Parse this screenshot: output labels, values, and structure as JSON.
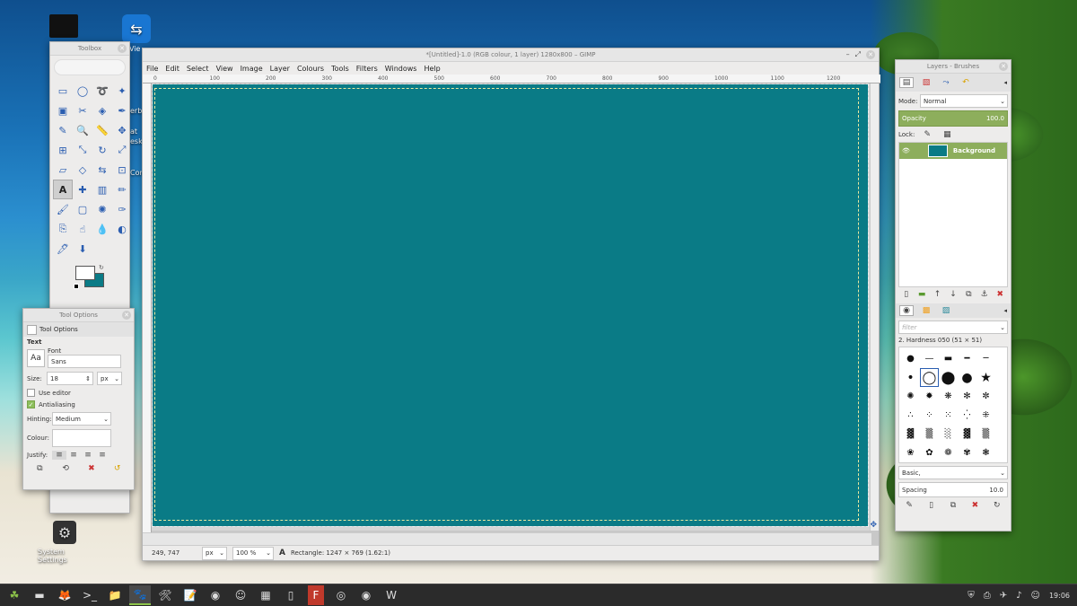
{
  "desktop": {
    "icons": [
      {
        "label": "",
        "glyph": "🖥"
      },
      {
        "label": "Vie",
        "glyph": "⇆"
      },
      {
        "label": "System Settings",
        "glyph": "⚙"
      }
    ],
    "side_fragments": [
      "erb",
      "at",
      "esk",
      "Con",
      "F"
    ]
  },
  "toolbox": {
    "title": "Toolbox",
    "tools": [
      "rect-select",
      "ellipse-select",
      "free-select",
      "fuzzy-select",
      "color-select",
      "scissors",
      "foreground-select",
      "paths",
      "color-picker",
      "zoom",
      "measure",
      "move",
      "align",
      "transform",
      "rotate",
      "scale",
      "shear",
      "perspective",
      "flip",
      "cage",
      "text",
      "heal",
      "gradient",
      "pencil",
      "paintbrush",
      "eraser",
      "airbrush",
      "ink",
      "clone",
      "smudge",
      "blur",
      "dodge",
      "mypaint",
      "bucket"
    ]
  },
  "tool_options": {
    "title": "Tool Options",
    "tab_label": "Tool Options",
    "section": "Text",
    "font_label": "Font",
    "font_preview": "Aa",
    "font_value": "Sans",
    "size_label": "Size:",
    "size_value": "18",
    "size_unit": "px",
    "use_editor": "Use editor",
    "antialiasing": "Antialiasing",
    "antialiasing_checked": true,
    "hinting_label": "Hinting:",
    "hinting_value": "Medium",
    "colour_label": "Colour:",
    "justify_label": "Justify:"
  },
  "gimp": {
    "title": "*[Untitled]-1.0 (RGB colour, 1 layer) 1280x800 – GIMP",
    "menu": [
      "File",
      "Edit",
      "Select",
      "View",
      "Image",
      "Layer",
      "Colours",
      "Tools",
      "Filters",
      "Windows",
      "Help"
    ],
    "ruler_ticks": [
      "0",
      "100",
      "200",
      "300",
      "400",
      "500",
      "600",
      "700",
      "800",
      "900",
      "1000",
      "1100",
      "1200"
    ],
    "canvas_color": "#0a7b86",
    "status": {
      "coords": "249, 747",
      "unit": "px",
      "zoom": "100 %",
      "message": "Rectangle: 1247 × 769  (1.62:1)"
    }
  },
  "layers": {
    "title": "Layers - Brushes",
    "mode_label": "Mode:",
    "mode_value": "Normal",
    "opacity_label": "Opacity",
    "opacity_value": "100.0",
    "lock_label": "Lock:",
    "layer_name": "Background",
    "filter_placeholder": "filter",
    "brush_name": "2. Hardness 050 (51 × 51)",
    "preset": "Basic,",
    "spacing_label": "Spacing",
    "spacing_value": "10.0"
  },
  "taskbar": {
    "clock": "19:06",
    "apps": [
      "menu",
      "files-green",
      "firefox",
      "terminal",
      "folder",
      "gimp",
      "gimp-tool",
      "text-editor",
      "chromium",
      "avatar",
      "calc",
      "document",
      "filezilla",
      "disk",
      "vlc",
      "writer"
    ]
  }
}
